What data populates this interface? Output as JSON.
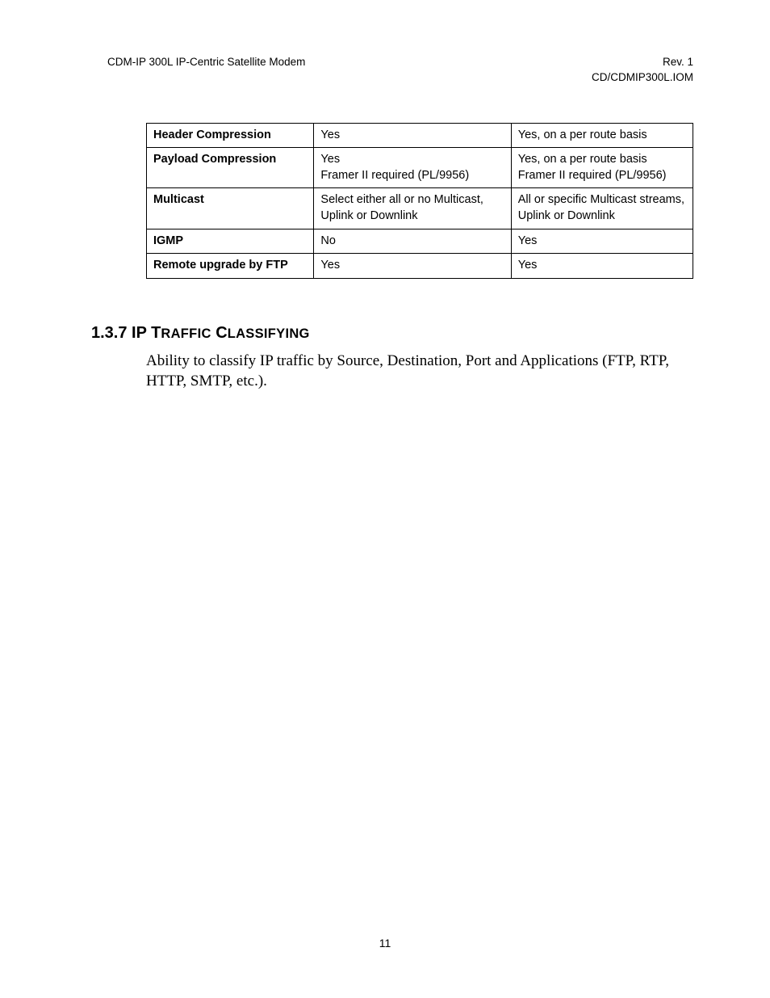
{
  "header": {
    "left": "CDM-IP 300L IP-Centric Satellite Modem",
    "right_line1": "Rev. 1",
    "right_line2": "CD/CDMIP300L.IOM"
  },
  "table": {
    "rows": [
      {
        "label": "Header Compression",
        "c2": "Yes",
        "c3": "Yes, on a per route basis"
      },
      {
        "label": "Payload Compression",
        "c2": "Yes\nFramer II required (PL/9956)",
        "c3": "Yes, on a per route basis\nFramer II required (PL/9956)"
      },
      {
        "label": "Multicast",
        "c2": "Select either all or no Multicast, Uplink or Downlink",
        "c3": "All or specific Multicast streams, Uplink or Downlink"
      },
      {
        "label": "IGMP",
        "c2": "No",
        "c3": "Yes"
      },
      {
        "label": "Remote upgrade by FTP",
        "c2": "Yes",
        "c3": "Yes"
      }
    ]
  },
  "section": {
    "number": "1.3.7",
    "title_word1_first": "IP",
    "title_word2_first": "T",
    "title_word2_rest": "RAFFIC",
    "title_word3_first": "C",
    "title_word3_rest": "LASSIFYING",
    "body": "Ability to classify IP traffic by Source, Destination, Port and Applications (FTP, RTP, HTTP, SMTP, etc.)."
  },
  "page_number": "11"
}
